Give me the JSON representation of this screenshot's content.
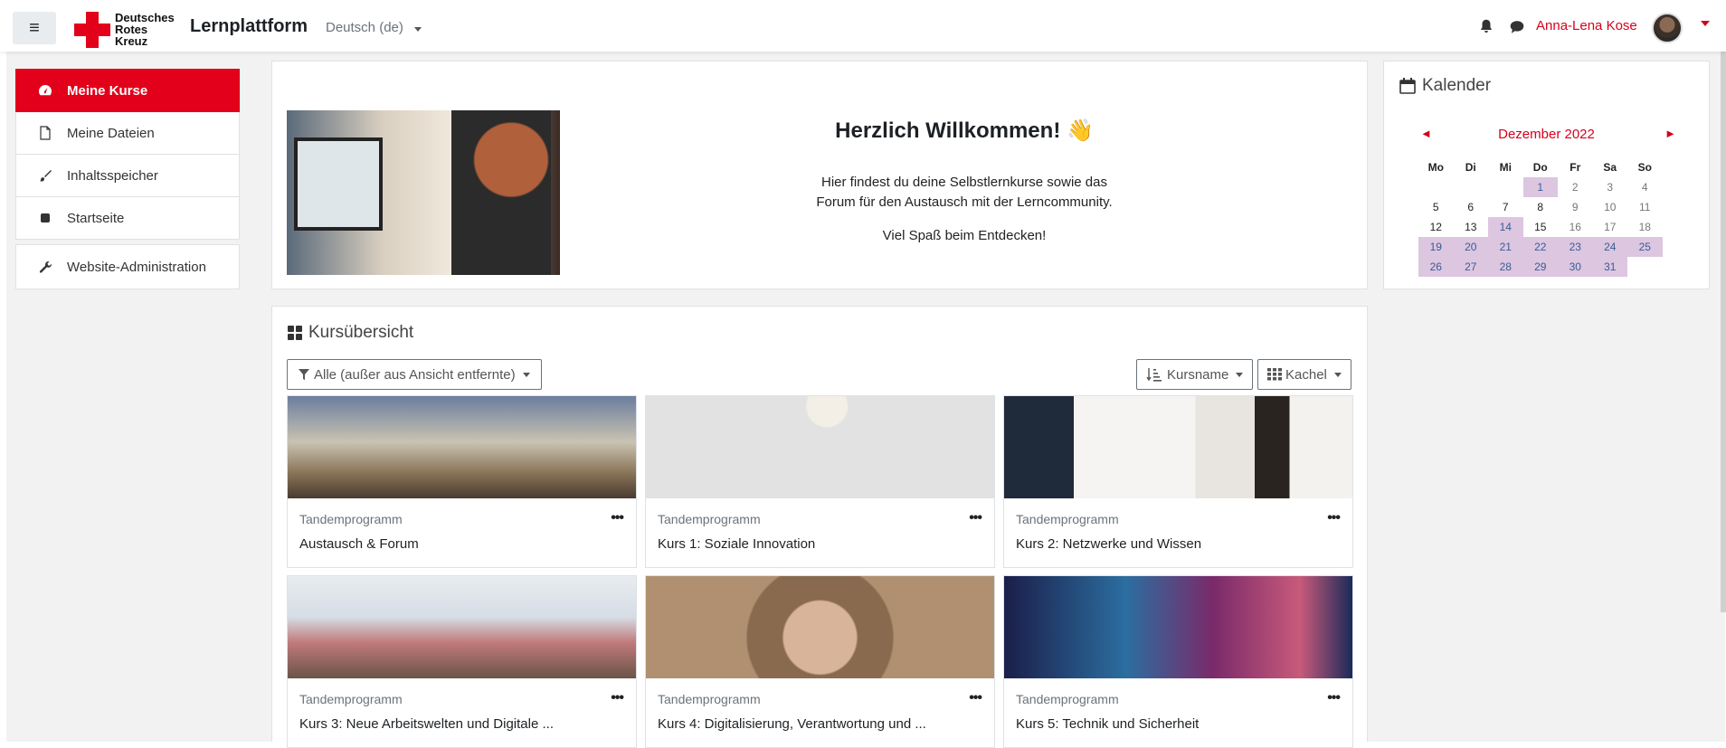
{
  "navbar": {
    "menu_icon": "hamburger-icon",
    "logo_lines": [
      "Deutsches",
      "Rotes",
      "Kreuz"
    ],
    "brand": "Lernplattform",
    "language": "Deutsch (de)",
    "user_name": "Anna-Lena Kose"
  },
  "leftnav": {
    "items": [
      {
        "label": "Meine Kurse",
        "icon": "dashboard-icon",
        "active": true
      },
      {
        "label": "Meine Dateien",
        "icon": "file-icon"
      },
      {
        "label": "Inhaltsspeicher",
        "icon": "brush-icon"
      },
      {
        "label": "Startseite",
        "icon": "home-icon"
      },
      {
        "label": "Website-Administration",
        "icon": "wrench-icon"
      }
    ]
  },
  "welcome": {
    "title": "Herzlich Willkommen! 👋",
    "line1": "Hier findest du deine Selbstlernkurse sowie das",
    "line2": "Forum für den Austausch mit der Lerncommunity.",
    "line3": "Viel Spaß beim Entdecken!"
  },
  "calendar": {
    "title": "Kalender",
    "month": "Dezember 2022",
    "prev": "◄",
    "next": "►",
    "days_of_week": [
      "Mo",
      "Di",
      "Mi",
      "Do",
      "Fr",
      "Sa",
      "So"
    ],
    "weeks": [
      [
        "",
        "",
        "",
        "1",
        "2",
        "3",
        "4"
      ],
      [
        "5",
        "6",
        "7",
        "8",
        "9",
        "10",
        "11"
      ],
      [
        "12",
        "13",
        "14",
        "15",
        "16",
        "17",
        "18"
      ],
      [
        "19",
        "20",
        "21",
        "22",
        "23",
        "24",
        "25"
      ],
      [
        "26",
        "27",
        "28",
        "29",
        "30",
        "31",
        ""
      ]
    ],
    "event_days": [
      "1",
      "14",
      "19",
      "20",
      "21",
      "22",
      "23",
      "24",
      "25",
      "26",
      "27",
      "28",
      "29",
      "30",
      "31"
    ]
  },
  "overview": {
    "title": "Kursübersicht",
    "filter": "Alle (außer aus Ansicht entfernte)",
    "sort": "Kursname",
    "view": "Kachel",
    "courses": [
      {
        "category": "Tandemprogramm",
        "name": "Austausch & Forum"
      },
      {
        "category": "Tandemprogramm",
        "name": "Kurs 1: Soziale Innovation"
      },
      {
        "category": "Tandemprogramm",
        "name": "Kurs 2: Netzwerke und Wissen"
      },
      {
        "category": "Tandemprogramm",
        "name": "Kurs 3: Neue Arbeitswelten und Digitale ..."
      },
      {
        "category": "Tandemprogramm",
        "name": "Kurs 4: Digitalisierung, Verantwortung und ..."
      },
      {
        "category": "Tandemprogramm",
        "name": "Kurs 5: Technik und Sicherheit"
      }
    ],
    "more_label": "•••"
  }
}
